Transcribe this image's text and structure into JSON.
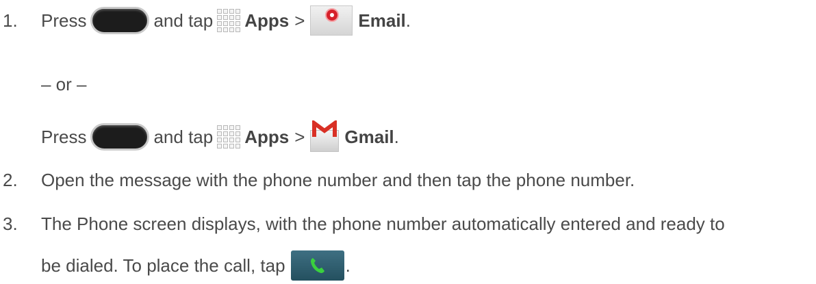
{
  "steps": [
    {
      "number": "1.",
      "line1": {
        "press": "Press",
        "and_tap": "and tap",
        "apps": "Apps",
        "sep": ">",
        "target": "Email",
        "end": "."
      },
      "or": "– or –",
      "line2": {
        "press": "Press",
        "and_tap": "and tap",
        "apps": "Apps",
        "sep": ">",
        "target": "Gmail",
        "end": "."
      }
    },
    {
      "number": "2.",
      "text": "Open the message with the phone number and then tap the phone number."
    },
    {
      "number": "3.",
      "text1": "The Phone screen displays, with the phone number automatically entered and ready to",
      "text2": "be dialed. To place the call, tap",
      "end": "."
    }
  ],
  "icons": {
    "home_key": "home-key-icon",
    "apps": "apps-grid-icon",
    "email": "email-app-icon",
    "gmail": "gmail-app-icon",
    "phone": "phone-call-button-icon"
  }
}
